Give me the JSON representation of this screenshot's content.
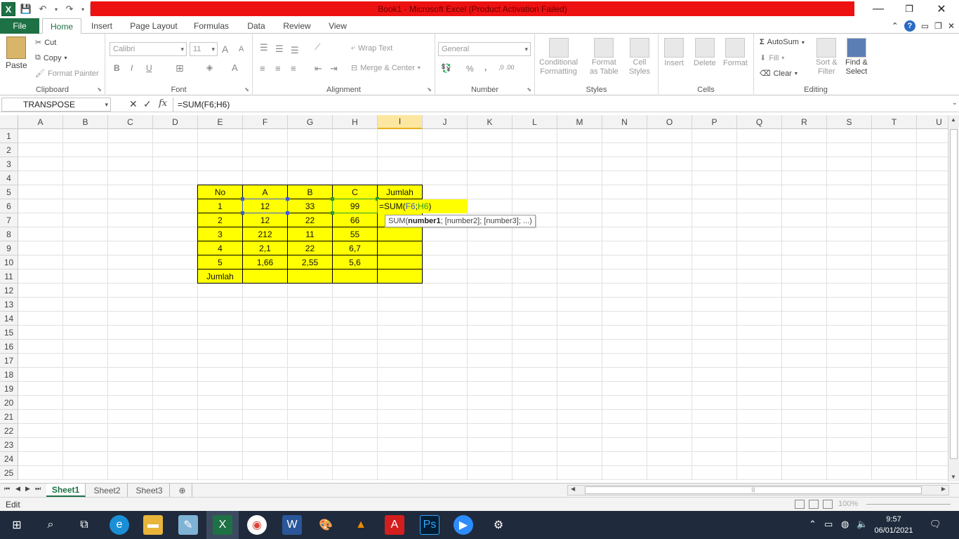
{
  "window": {
    "title": "Book1  -  Microsoft Excel (Product Activation Failed)",
    "logo": "X",
    "title_color": "#ee1111",
    "accent_color": "#1e7145"
  },
  "ribbon_tabs": {
    "file": "File",
    "items": [
      "Home",
      "Insert",
      "Page Layout",
      "Formulas",
      "Data",
      "Review",
      "View"
    ],
    "active": "Home"
  },
  "ribbon": {
    "clipboard": {
      "label": "Clipboard",
      "paste": "Paste",
      "cut": "Cut",
      "copy": "Copy",
      "format_painter": "Format Painter"
    },
    "font": {
      "label": "Font",
      "name": "Calibri",
      "size": "11",
      "bold": "B",
      "italic": "I",
      "underline": "U",
      "grow": "A",
      "shrink": "A",
      "color": "A"
    },
    "alignment": {
      "label": "Alignment",
      "wrap_text": "Wrap Text",
      "merge_center": "Merge & Center"
    },
    "number": {
      "label": "Number",
      "format": "General",
      "percent": "%",
      "comma": ",",
      "inc_decimal": ",0 .00",
      "dec_decimal": ".00 ,0"
    },
    "styles": {
      "label": "Styles",
      "conditional": "Conditional",
      "conditional2": "Formatting",
      "format_table": "Format",
      "format_table2": "as Table",
      "cell_styles": "Cell",
      "cell_styles2": "Styles"
    },
    "cells": {
      "label": "Cells",
      "insert": "Insert",
      "delete": "Delete",
      "format": "Format"
    },
    "editing": {
      "label": "Editing",
      "autosum": "AutoSum",
      "fill": "Fill",
      "clear": "Clear",
      "sort": "Sort &",
      "sort2": "Filter",
      "find": "Find &",
      "find2": "Select"
    }
  },
  "formula_bar": {
    "name_box": "TRANSPOSE",
    "cancel": "✕",
    "enter": "✓",
    "fx": "fx",
    "formula": "=SUM(F6;H6)"
  },
  "columns": [
    "A",
    "B",
    "C",
    "D",
    "E",
    "F",
    "G",
    "H",
    "I",
    "J",
    "K",
    "L",
    "M",
    "N",
    "O",
    "P",
    "Q",
    "R",
    "S",
    "T",
    "U"
  ],
  "selected_column": "I",
  "rows": [
    "1",
    "2",
    "3",
    "4",
    "5",
    "6",
    "7",
    "8",
    "9",
    "10",
    "11",
    "12",
    "13",
    "14",
    "15",
    "16",
    "17",
    "18",
    "19",
    "20",
    "21",
    "22",
    "23",
    "24",
    "25"
  ],
  "table": {
    "header": [
      "No",
      "A",
      "B",
      "C",
      "Jumlah"
    ],
    "rows": [
      [
        "1",
        "12",
        "33",
        "99",
        ""
      ],
      [
        "2",
        "12",
        "22",
        "66",
        ""
      ],
      [
        "3",
        "212",
        "11",
        "55",
        ""
      ],
      [
        "4",
        "2,1",
        "22",
        "6,7",
        ""
      ],
      [
        "5",
        "1,66",
        "2,55",
        "5,6",
        ""
      ]
    ],
    "footer": [
      "Jumlah",
      "",
      "",
      "",
      ""
    ],
    "fill_color": "#ffff00"
  },
  "edit_cell": {
    "part1": "=SUM(",
    "part2": "F6",
    "part3": ";",
    "part4": "H6",
    "part5": ")"
  },
  "tooltip": {
    "prefix": "SUM(",
    "bold_arg": "number1",
    "rest": "; [number2]; [number3]; ...)"
  },
  "sheets": [
    "Sheet1",
    "Sheet2",
    "Sheet3"
  ],
  "active_sheet": "Sheet1",
  "status": {
    "mode": "Edit",
    "zoom": "100%"
  },
  "clock": {
    "time": "9:57",
    "date": "06/01/2021"
  }
}
